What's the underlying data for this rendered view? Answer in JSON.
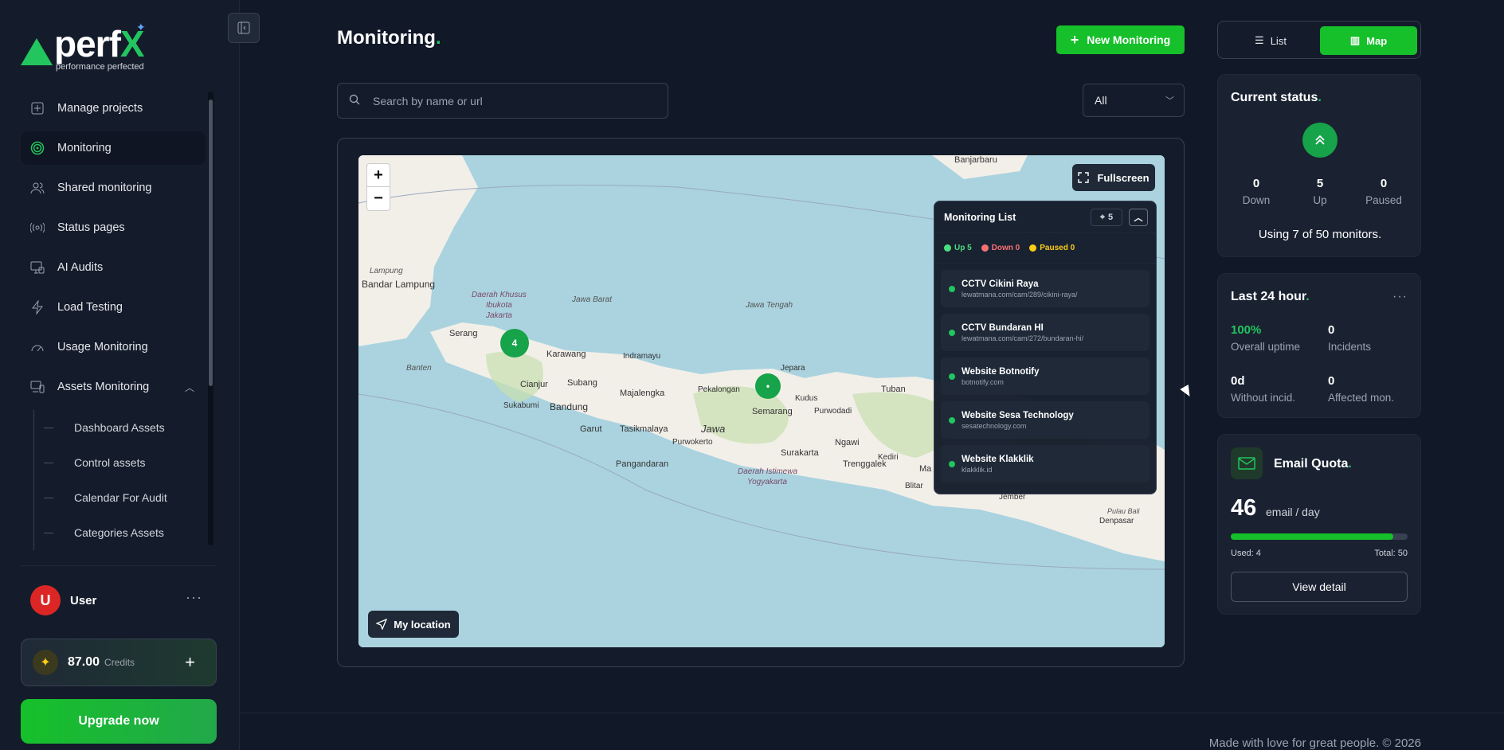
{
  "app": {
    "logo_text": "perf",
    "logo_x": "X",
    "tagline": "performance perfected"
  },
  "sidebar": {
    "items": [
      {
        "label": "Manage projects",
        "icon": "plus-square-icon"
      },
      {
        "label": "Monitoring",
        "icon": "target-icon",
        "active": true
      },
      {
        "label": "Shared monitoring",
        "icon": "users-icon"
      },
      {
        "label": "Status pages",
        "icon": "broadcast-icon"
      },
      {
        "label": "AI Audits",
        "icon": "monitor-check-icon"
      },
      {
        "label": "Load Testing",
        "icon": "lightning-icon"
      },
      {
        "label": "Usage Monitoring",
        "icon": "gauge-icon"
      },
      {
        "label": "Assets Monitoring",
        "icon": "devices-icon",
        "expanded": true
      }
    ],
    "sub_items": [
      {
        "label": "Dashboard Assets"
      },
      {
        "label": "Control assets"
      },
      {
        "label": "Calendar For Audit"
      },
      {
        "label": "Categories Assets"
      }
    ],
    "user": {
      "initial": "U",
      "name": "User",
      "more": "···"
    },
    "credits": {
      "amount": "87.00",
      "label": "Credits",
      "add": "+"
    },
    "upgrade_label": "Upgrade now"
  },
  "header": {
    "title": "Monitoring",
    "title_dot": ".",
    "new_button": "New Monitoring",
    "new_button_icon": "+"
  },
  "search": {
    "placeholder": "Search by name or url"
  },
  "filter": {
    "selected": "All"
  },
  "view_toggle": {
    "list": "List",
    "map": "Map",
    "active": "Map"
  },
  "map": {
    "zoom_in": "+",
    "zoom_out": "−",
    "fullscreen": "Fullscreen",
    "my_location": "My location",
    "clusters": [
      {
        "label": "4"
      },
      {
        "label": "•"
      }
    ],
    "place_labels": [
      "Banjarbaru",
      "Lampung",
      "Bandar Lampung",
      "Daerah Khusus",
      "Ibukota",
      "Jakarta",
      "Jawa Barat",
      "Jawa Tengah",
      "Serang",
      "Jakarta",
      "Karawang",
      "Indramayu",
      "Banten",
      "Cianjur",
      "Subang",
      "Majalengka",
      "Pekalongan",
      "Jepara",
      "Tuban",
      "Sukabumi",
      "Bandung",
      "Semarang",
      "Kudus",
      "Purwodadi",
      "Garut",
      "Tasikmalaya",
      "Purwokerto",
      "Jawa",
      "Ngawi",
      "Pangandaran",
      "Surakarta",
      "Daerah Istimewa",
      "Yogyakarta",
      "Trenggalek",
      "Blitar",
      "Kediri",
      "Jember",
      "Pulau Bali",
      "Denpasar",
      "Ma"
    ],
    "monitoring_list": {
      "title": "Monitoring List",
      "count": "5",
      "legend": [
        {
          "label": "Up 5",
          "color": "#4ade80"
        },
        {
          "label": "Down 0",
          "color": "#f87171"
        },
        {
          "label": "Paused 0",
          "color": "#facc15"
        }
      ],
      "items": [
        {
          "name": "CCTV Cikini Raya",
          "url": "lewatmana.com/cam/289/cikini-raya/"
        },
        {
          "name": "CCTV Bundaran HI",
          "url": "lewatmana.com/cam/272/bundaran-hi/"
        },
        {
          "name": "Website Botnotify",
          "url": "botnotify.com"
        },
        {
          "name": "Website Sesa Technology",
          "url": "sesatechnology.com"
        },
        {
          "name": "Website Klakklik",
          "url": "klakklik.id"
        }
      ]
    }
  },
  "current_status": {
    "title": "Current status",
    "dot": ".",
    "down": {
      "value": "0",
      "label": "Down"
    },
    "up": {
      "value": "5",
      "label": "Up"
    },
    "paused": {
      "value": "0",
      "label": "Paused"
    },
    "using": "Using 7 of 50 monitors."
  },
  "last24": {
    "title": "Last 24 hour",
    "dot": ".",
    "more": "···",
    "uptime": {
      "value": "100%",
      "label": "Overall uptime"
    },
    "incidents": {
      "value": "0",
      "label": "Incidents"
    },
    "without": {
      "value": "0d",
      "label": "Without incid."
    },
    "affected": {
      "value": "0",
      "label": "Affected mon."
    }
  },
  "email_quota": {
    "title": "Email Quota",
    "dot": ".",
    "value": "46",
    "unit": "email / day",
    "used": "Used: 4",
    "total": "Total: 50",
    "fill_fraction": 0.92,
    "button": "View detail"
  },
  "footer": {
    "text": "Made with love for great people. © 2026"
  },
  "colors": {
    "accent": "#16c02a",
    "bg": "#111827",
    "card": "#1a2232"
  }
}
